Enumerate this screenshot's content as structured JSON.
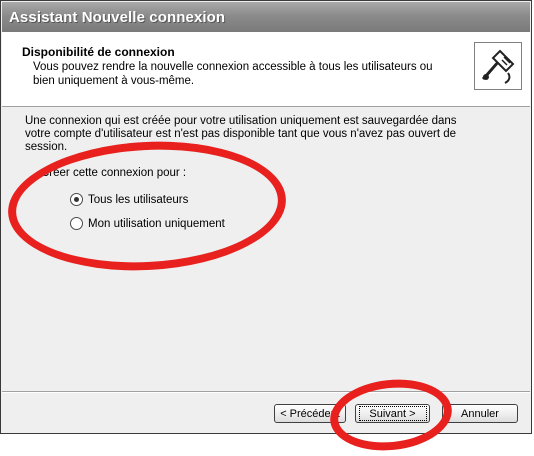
{
  "window": {
    "title": "Assistant Nouvelle connexion"
  },
  "header": {
    "title": "Disponibilité de connexion",
    "description": "Vous pouvez rendre la nouvelle connexion accessible à tous les utilisateurs ou bien uniquement à vous-même.",
    "icon": "network-cable-icon"
  },
  "body": {
    "paragraph": "Une connexion qui est créée pour votre utilisation uniquement est sauvegardée dans votre compte d'utilisateur est n'est pas disponible tant que vous n'avez pas ouvert de session.",
    "group_label": "Créer cette connexion pour :",
    "options": [
      {
        "label": "Tous les utilisateurs",
        "selected": true
      },
      {
        "label": "Mon utilisation uniquement",
        "selected": false
      }
    ]
  },
  "footer": {
    "back_label": "< Précédent",
    "next_label": "Suivant >",
    "cancel_label": "Annuler"
  },
  "colors": {
    "titlebar": "#8b8b8b",
    "annotation": "#e8201e",
    "dialog_background": "#efefef"
  }
}
